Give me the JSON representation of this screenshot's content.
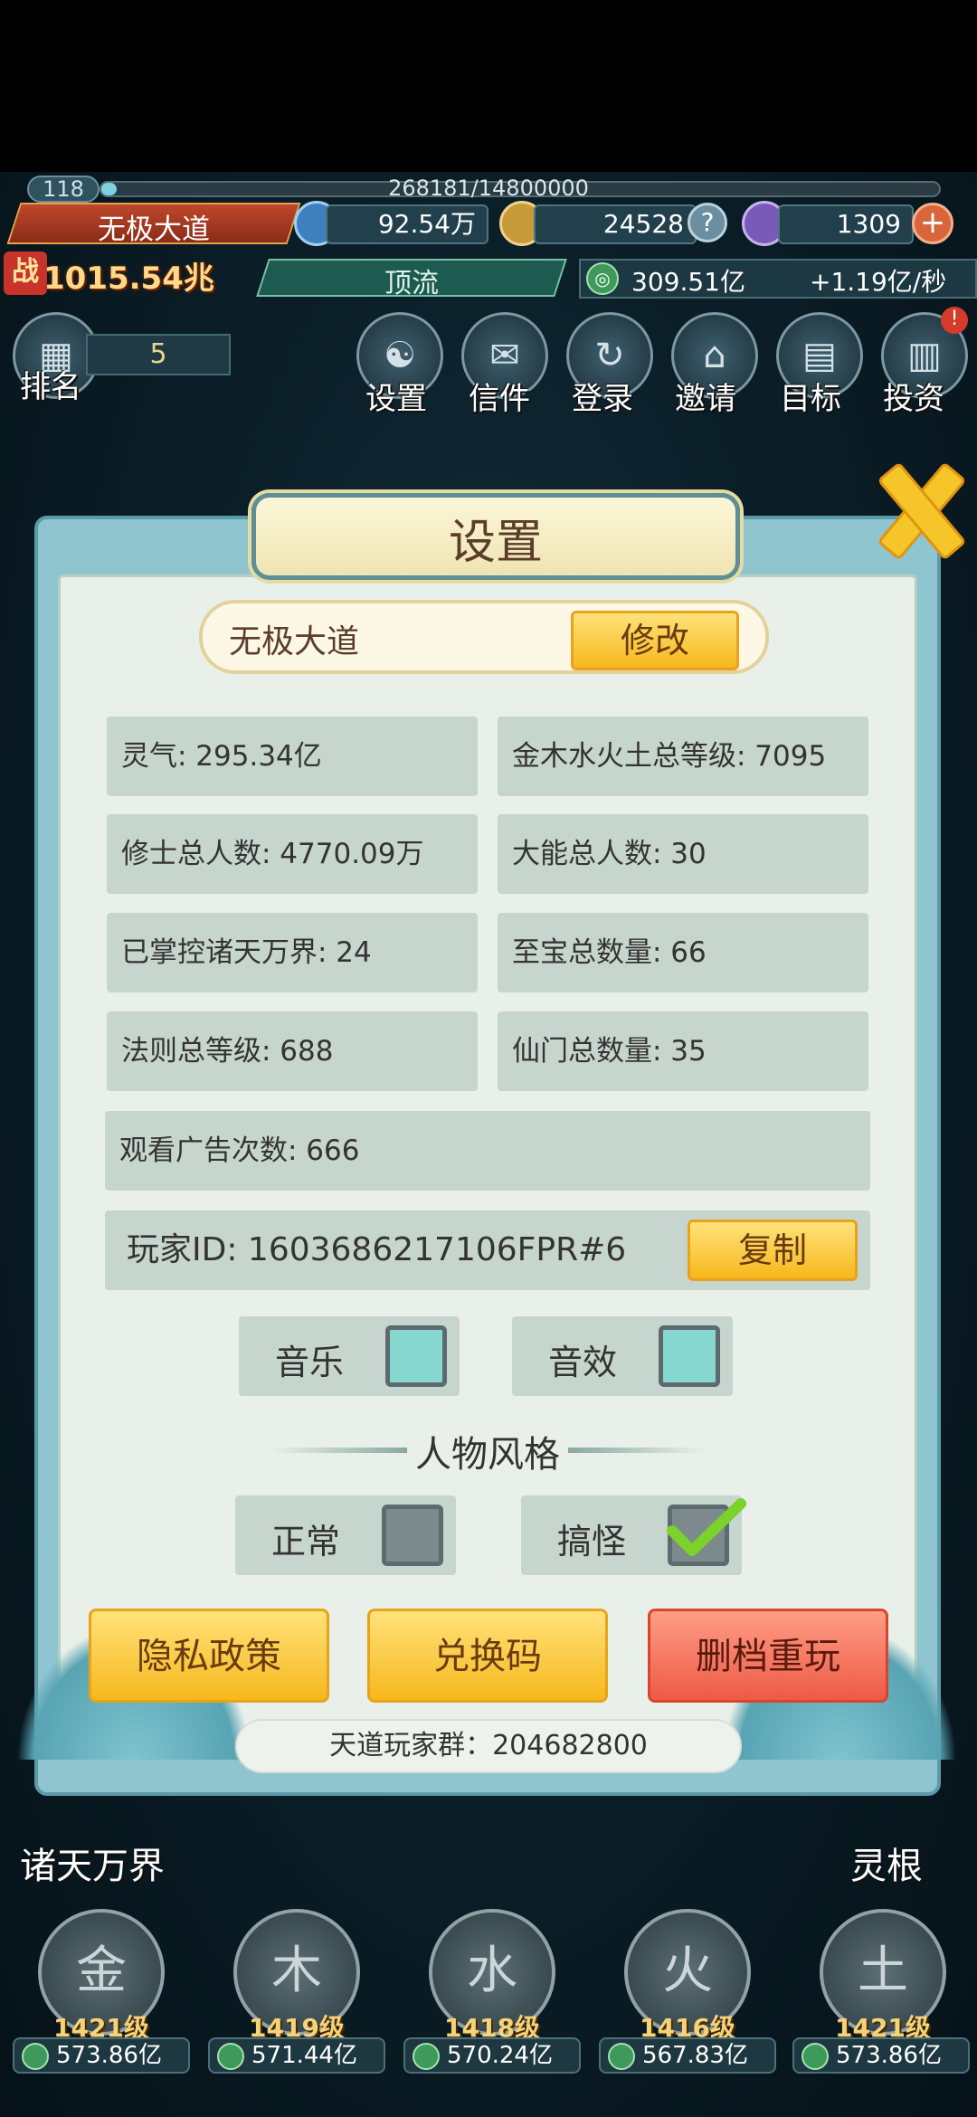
{
  "hud": {
    "level": "118",
    "exp_text": "268181/14800000",
    "exp_fraction": 0.018,
    "player_name": "无极大道",
    "power_badge": "战",
    "power": "1015.54兆",
    "res1": "92.54万",
    "res2": "24528",
    "res3": "1309",
    "rank_title": "顶流",
    "spirit": "309.51亿",
    "spirit_rate": "+1.19亿/秒"
  },
  "toprow": {
    "rank_label": "排名",
    "rank_value": "5",
    "buttons": [
      {
        "label": "设置",
        "icon": "yin-yang-icon"
      },
      {
        "label": "信件",
        "icon": "letter-icon"
      },
      {
        "label": "登录",
        "icon": "swirl-icon"
      },
      {
        "label": "邀请",
        "icon": "pavilion-icon"
      },
      {
        "label": "目标",
        "icon": "scroll-icon"
      },
      {
        "label": "投资",
        "icon": "chart-icon"
      }
    ],
    "invest_badge": "!"
  },
  "modal": {
    "title": "设置",
    "name": "无极大道",
    "modify": "修改",
    "info": [
      "灵气: 295.34亿",
      "金木水火土总等级: 7095",
      "修士总人数: 4770.09万",
      "大能总人数: 30",
      "已掌控诸天万界: 24",
      "至宝总数量: 66",
      "法则总等级: 688",
      "仙门总数量: 35"
    ],
    "ads": "观看广告次数: 666",
    "player_id": "玩家ID: 1603686217106FPR#6",
    "copy": "复制",
    "music": "音乐",
    "sfx": "音效",
    "style_title": "人物风格",
    "normal": "正常",
    "quirky": "搞怪",
    "privacy": "隐私政策",
    "redeem": "兑换码",
    "reset": "删档重玩",
    "group": "天道玩家群：204682800"
  },
  "bottom": {
    "left_label": "诸天万界",
    "right_label": "灵根",
    "elements": [
      {
        "glyph": "金",
        "level": "1421级",
        "cost": "573.86亿"
      },
      {
        "glyph": "木",
        "level": "1419级",
        "cost": "571.44亿"
      },
      {
        "glyph": "水",
        "level": "1418级",
        "cost": "570.24亿"
      },
      {
        "glyph": "火",
        "level": "1416级",
        "cost": "567.83亿"
      },
      {
        "glyph": "土",
        "level": "1421级",
        "cost": "573.86亿"
      }
    ]
  },
  "colors": {
    "gold": "#f6b81c",
    "reset_red": "#f2705a",
    "panel": "#e9f0ea",
    "check_green": "#7bd22a"
  }
}
